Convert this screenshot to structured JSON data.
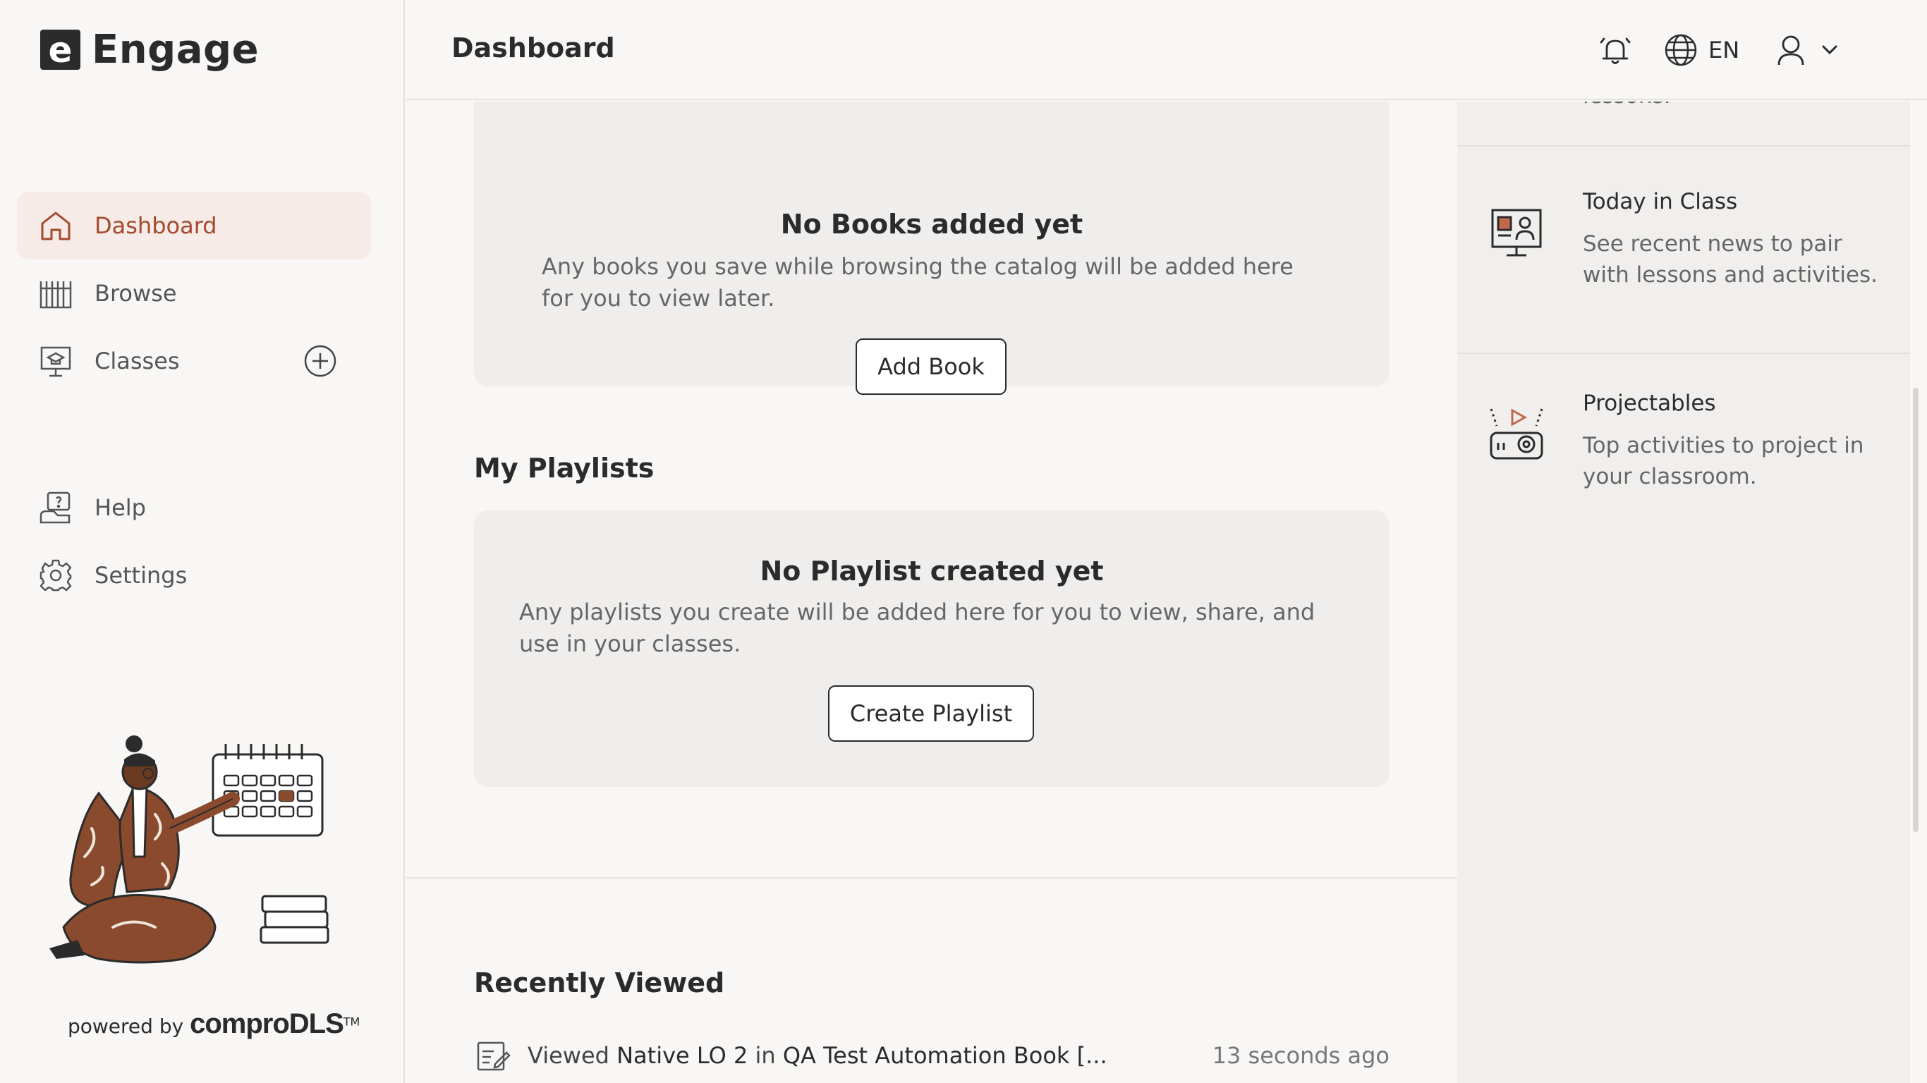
{
  "app": {
    "logo_letter": "e",
    "name": "Engage"
  },
  "sidebar": {
    "items": [
      {
        "label": "Dashboard",
        "icon": "home-icon",
        "active": true
      },
      {
        "label": "Browse",
        "icon": "books-icon"
      },
      {
        "label": "Classes",
        "icon": "classroom-icon"
      },
      {
        "label": "Help",
        "icon": "help-icon"
      },
      {
        "label": "Settings",
        "icon": "gear-icon"
      }
    ],
    "add_class_icon": "plus-circle-icon",
    "powered_by": "powered by",
    "powered_brand": "comproDLS",
    "powered_tm": "TM"
  },
  "header": {
    "title": "Dashboard",
    "notification_icon": "bell-icon",
    "language_icon": "globe-icon",
    "language": "EN",
    "user_icon": "user-icon",
    "chevron_icon": "chevron-down-icon"
  },
  "main": {
    "books": {
      "empty_title": "No Books added yet",
      "empty_desc": "Any books you save while browsing the catalog will be added here for you to view later.",
      "button": "Add Book"
    },
    "playlists": {
      "section_title": "My Playlists",
      "empty_title": "No Playlist created yet",
      "empty_desc": "Any playlists you create will be added here for you to view, share, and use in your classes.",
      "button": "Create Playlist"
    },
    "recently_viewed": {
      "section_title": "Recently Viewed",
      "items": [
        {
          "prefix": "Viewed",
          "item": "Native LO 2",
          "joiner": "in",
          "book": "QA Test Automation Book [...",
          "time": "13 seconds ago"
        }
      ]
    }
  },
  "right_panel": {
    "partial_text": "lessons.",
    "items": [
      {
        "title": "Today in Class",
        "desc": "See recent news to pair with lessons and activities.",
        "icon": "news-screen-icon"
      },
      {
        "title": "Projectables",
        "desc": "Top activities to project in your classroom.",
        "icon": "projector-icon"
      }
    ]
  },
  "colors": {
    "accent": "#a34a2f",
    "active_bg": "#f7ebe7",
    "text": "#2b2b2b",
    "card_bg": "#efeeed"
  }
}
